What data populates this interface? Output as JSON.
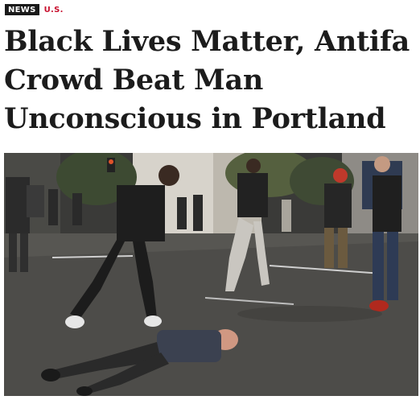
{
  "article": {
    "category_badge": "NEWS",
    "section_link": "U.S.",
    "headline": "Black Lives Matter, Antifa Crowd Beat Man Unconscious in Portland"
  },
  "colors": {
    "badge_background": "#1a1a1a",
    "section_link": "#c8102e",
    "headline_text": "#1c1c1c"
  },
  "photo": {
    "icon": "news-photo-icon"
  }
}
